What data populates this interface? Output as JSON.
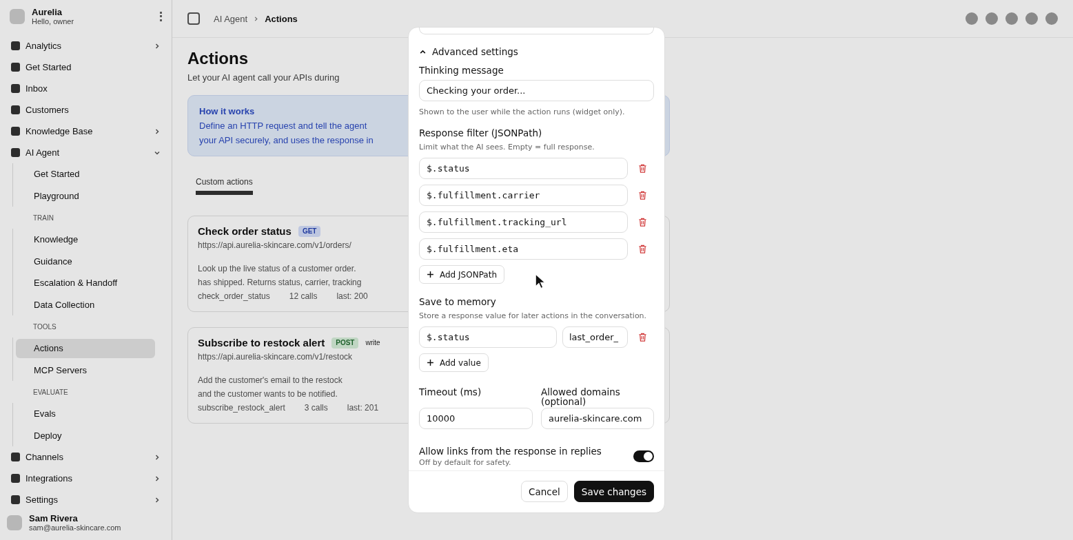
{
  "sidebar": {
    "brand": "Aurelia",
    "subtitle": "Hello, owner",
    "items": [
      {
        "kind": "item",
        "label": "Analytics",
        "expanded": false,
        "selected": false
      },
      {
        "kind": "item",
        "label": "Get Started",
        "selected": false
      },
      {
        "kind": "item",
        "label": "Inbox",
        "selected": false
      },
      {
        "kind": "item",
        "label": "Customers",
        "selected": false
      },
      {
        "kind": "item",
        "label": "Knowledge Base",
        "expanded": false,
        "selected": false
      },
      {
        "kind": "item",
        "label": "AI Agent",
        "expanded": true,
        "selected": false
      },
      {
        "kind": "sub",
        "label": "Get Started",
        "selected": false
      },
      {
        "kind": "sub",
        "label": "Playground",
        "selected": false
      },
      {
        "kind": "section",
        "label": "TRAIN"
      },
      {
        "kind": "sub",
        "label": "Knowledge",
        "selected": false
      },
      {
        "kind": "sub",
        "label": "Guidance",
        "selected": false
      },
      {
        "kind": "sub",
        "label": "Escalation & Handoff",
        "selected": false
      },
      {
        "kind": "sub",
        "label": "Data Collection",
        "selected": false
      },
      {
        "kind": "section",
        "label": "TOOLS"
      },
      {
        "kind": "sub",
        "label": "Actions",
        "selected": true
      },
      {
        "kind": "sub",
        "label": "MCP Servers",
        "selected": false
      },
      {
        "kind": "section",
        "label": "EVALUATE"
      },
      {
        "kind": "sub",
        "label": "Evals",
        "selected": false
      },
      {
        "kind": "sub",
        "label": "Deploy",
        "selected": false
      },
      {
        "kind": "item",
        "label": "Channels",
        "expanded": false,
        "selected": false
      },
      {
        "kind": "item",
        "label": "Integrations",
        "expanded": false,
        "selected": false
      },
      {
        "kind": "item",
        "label": "Settings",
        "expanded": false,
        "selected": false
      }
    ],
    "user": {
      "name": "Sam Rivera",
      "email": "sam@aurelia-skincare.com"
    }
  },
  "breadcrumb": [
    "AI Agent",
    "Actions"
  ],
  "page": {
    "title": "Actions",
    "subtitle": "Let your AI agent call your APIs during",
    "info": {
      "title": "How it works",
      "lines": [
        "Define an HTTP request and tell the agent",
        "your API securely, and uses the response in"
      ]
    },
    "tabs": [
      {
        "label": "Custom actions",
        "selected": true
      }
    ],
    "actions": [
      {
        "name": "Check order status",
        "method": "GET",
        "url": "https://api.aurelia-skincare.com/v1/orders/",
        "description": [
          "Look up the live status of a customer order.",
          "has shipped. Returns status, carrier, tracking"
        ],
        "meta": [
          "check_order_status",
          "12 calls",
          "last: 200"
        ]
      },
      {
        "name": "Subscribe to restock alert",
        "method": "POST",
        "tag": "write",
        "url": "https://api.aurelia-skincare.com/v1/restock",
        "description": [
          "Add the customer's email to the restock",
          "and the customer wants to be notified."
        ],
        "meta": [
          "subscribe_restock_alert",
          "3 calls",
          "last: 201"
        ]
      }
    ]
  },
  "modal": {
    "advanced": {
      "label": "Advanced settings",
      "expanded": true
    },
    "thinking": {
      "label": "Thinking message",
      "value": "Checking your order...",
      "hint": "Shown to the user while the action runs (widget only)."
    },
    "filter": {
      "label": "Response filter (JSONPath)",
      "hint": "Limit what the AI sees. Empty = full response.",
      "paths": [
        "$.status",
        "$.fulfillment.carrier",
        "$.fulfillment.tracking_url",
        "$.fulfillment.eta"
      ],
      "add": "Add JSONPath"
    },
    "memory": {
      "label": "Save to memory",
      "hint": "Store a response value for later actions in the conversation.",
      "rows": [
        {
          "path": "$.status",
          "key": "last_order_"
        }
      ],
      "add": "Add value"
    },
    "timeout": {
      "label": "Timeout (ms)",
      "value": "10000"
    },
    "domains": {
      "label": "Allowed domains (optional)",
      "value": "aurelia-skincare.com"
    },
    "links": {
      "label": "Allow links from the response in replies",
      "hint": "Off by default for safety.",
      "on": true
    },
    "cancel": "Cancel",
    "save": "Save changes"
  }
}
